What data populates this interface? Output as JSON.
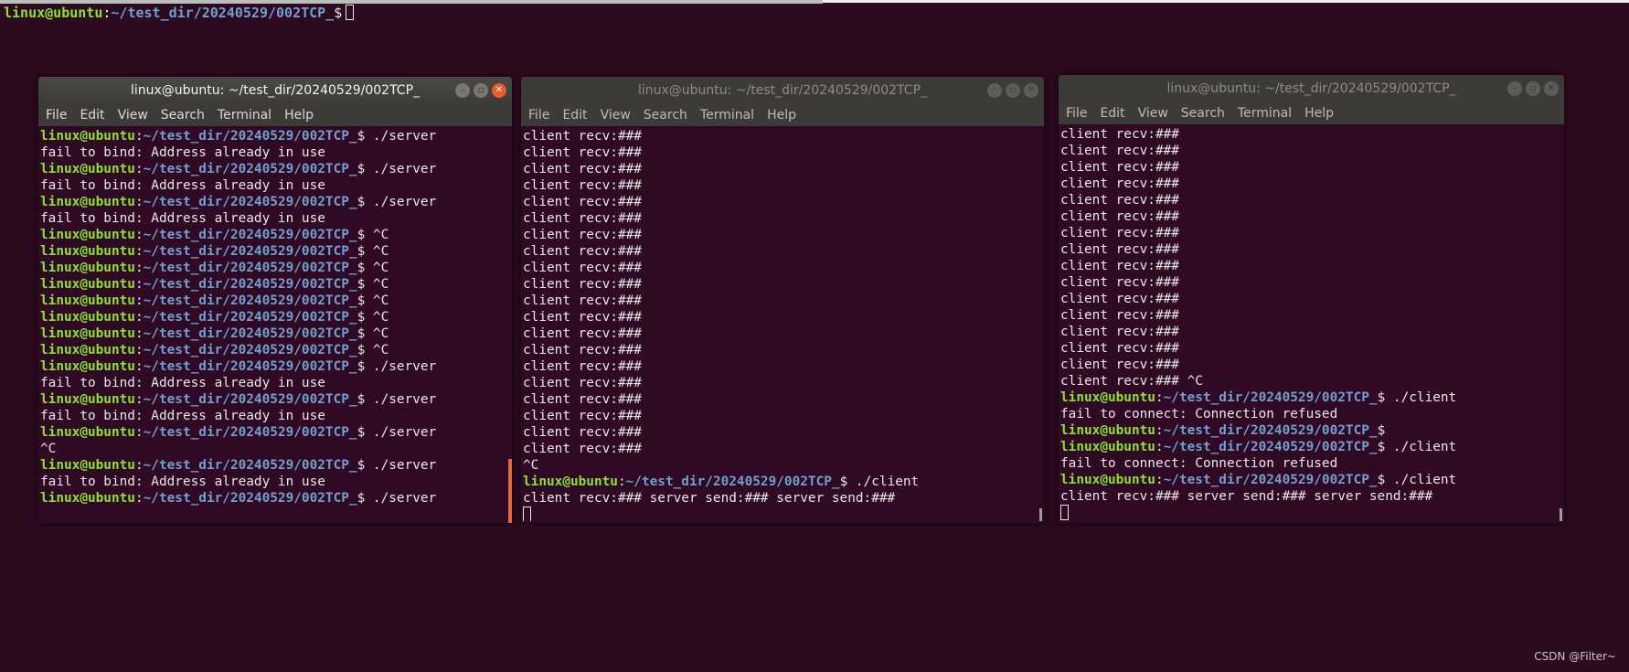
{
  "background_prompt": {
    "user": "linux@ubuntu",
    "path": "~/test_dir/20240529/002TCP_",
    "symbol": "$"
  },
  "windows": [
    {
      "title": "linux@ubuntu: ~/test_dir/20240529/002TCP_",
      "menu": [
        "File",
        "Edit",
        "View",
        "Search",
        "Terminal",
        "Help"
      ],
      "lines": [
        {
          "type": "prompt",
          "cmd": " ./server"
        },
        {
          "type": "out",
          "text": "fail to bind: Address already in use"
        },
        {
          "type": "prompt",
          "cmd": " ./server"
        },
        {
          "type": "out",
          "text": "fail to bind: Address already in use"
        },
        {
          "type": "prompt",
          "cmd": " ./server"
        },
        {
          "type": "out",
          "text": "fail to bind: Address already in use"
        },
        {
          "type": "prompt",
          "cmd": " ^C"
        },
        {
          "type": "prompt",
          "cmd": " ^C"
        },
        {
          "type": "prompt",
          "cmd": " ^C"
        },
        {
          "type": "prompt",
          "cmd": " ^C"
        },
        {
          "type": "prompt",
          "cmd": " ^C"
        },
        {
          "type": "prompt",
          "cmd": " ^C"
        },
        {
          "type": "prompt",
          "cmd": " ^C"
        },
        {
          "type": "prompt",
          "cmd": " ^C"
        },
        {
          "type": "prompt",
          "cmd": " ./server"
        },
        {
          "type": "out",
          "text": "fail to bind: Address already in use"
        },
        {
          "type": "prompt",
          "cmd": " ./server"
        },
        {
          "type": "out",
          "text": "fail to bind: Address already in use"
        },
        {
          "type": "prompt",
          "cmd": " ./server"
        },
        {
          "type": "out",
          "text": "^C"
        },
        {
          "type": "prompt",
          "cmd": " ./server"
        },
        {
          "type": "out",
          "text": "fail to bind: Address already in use"
        },
        {
          "type": "prompt",
          "cmd": " ./server"
        }
      ]
    },
    {
      "title": "linux@ubuntu: ~/test_dir/20240529/002TCP_",
      "menu": [
        "File",
        "Edit",
        "View",
        "Search",
        "Terminal",
        "Help"
      ],
      "lines": [
        {
          "type": "out",
          "text": "client recv:###"
        },
        {
          "type": "out",
          "text": "client recv:###"
        },
        {
          "type": "out",
          "text": "client recv:###"
        },
        {
          "type": "out",
          "text": "client recv:###"
        },
        {
          "type": "out",
          "text": "client recv:###"
        },
        {
          "type": "out",
          "text": "client recv:###"
        },
        {
          "type": "out",
          "text": "client recv:###"
        },
        {
          "type": "out",
          "text": "client recv:###"
        },
        {
          "type": "out",
          "text": "client recv:###"
        },
        {
          "type": "out",
          "text": "client recv:###"
        },
        {
          "type": "out",
          "text": "client recv:###"
        },
        {
          "type": "out",
          "text": "client recv:###"
        },
        {
          "type": "out",
          "text": "client recv:###"
        },
        {
          "type": "out",
          "text": "client recv:###"
        },
        {
          "type": "out",
          "text": "client recv:###"
        },
        {
          "type": "out",
          "text": "client recv:###"
        },
        {
          "type": "out",
          "text": "client recv:###"
        },
        {
          "type": "out",
          "text": "client recv:###"
        },
        {
          "type": "out",
          "text": "client recv:###"
        },
        {
          "type": "out",
          "text": "client recv:###"
        },
        {
          "type": "out",
          "text": "^C"
        },
        {
          "type": "prompt",
          "cmd": " ./client"
        },
        {
          "type": "out",
          "text": "client recv:### server send:### server send:###"
        },
        {
          "type": "cursor"
        }
      ]
    },
    {
      "title": "linux@ubuntu: ~/test_dir/20240529/002TCP_",
      "menu": [
        "File",
        "Edit",
        "View",
        "Search",
        "Terminal",
        "Help"
      ],
      "lines": [
        {
          "type": "out",
          "text": "client recv:###"
        },
        {
          "type": "out",
          "text": "client recv:###"
        },
        {
          "type": "out",
          "text": "client recv:###"
        },
        {
          "type": "out",
          "text": "client recv:###"
        },
        {
          "type": "out",
          "text": "client recv:###"
        },
        {
          "type": "out",
          "text": "client recv:###"
        },
        {
          "type": "out",
          "text": "client recv:###"
        },
        {
          "type": "out",
          "text": "client recv:###"
        },
        {
          "type": "out",
          "text": "client recv:###"
        },
        {
          "type": "out",
          "text": "client recv:###"
        },
        {
          "type": "out",
          "text": "client recv:###"
        },
        {
          "type": "out",
          "text": "client recv:###"
        },
        {
          "type": "out",
          "text": "client recv:###"
        },
        {
          "type": "out",
          "text": "client recv:###"
        },
        {
          "type": "out",
          "text": "client recv:###"
        },
        {
          "type": "out",
          "text": "client recv:### ^C"
        },
        {
          "type": "prompt",
          "cmd": " ./client"
        },
        {
          "type": "out",
          "text": "fail to connect: Connection refused"
        },
        {
          "type": "prompt",
          "cmd": ""
        },
        {
          "type": "prompt",
          "cmd": " ./client"
        },
        {
          "type": "out",
          "text": "fail to connect: Connection refused"
        },
        {
          "type": "prompt",
          "cmd": " ./client"
        },
        {
          "type": "out",
          "text": "client recv:### server send:### server send:###"
        },
        {
          "type": "cursor"
        }
      ]
    }
  ],
  "prompt": {
    "user": "linux@ubuntu",
    "sep": ":",
    "path": "~/test_dir/20240529/002TCP_",
    "symbol": "$"
  },
  "icons": {
    "minimize": "minimize-icon",
    "maximize": "maximize-icon",
    "close": "close-icon"
  },
  "watermark": "CSDN @Filter~"
}
